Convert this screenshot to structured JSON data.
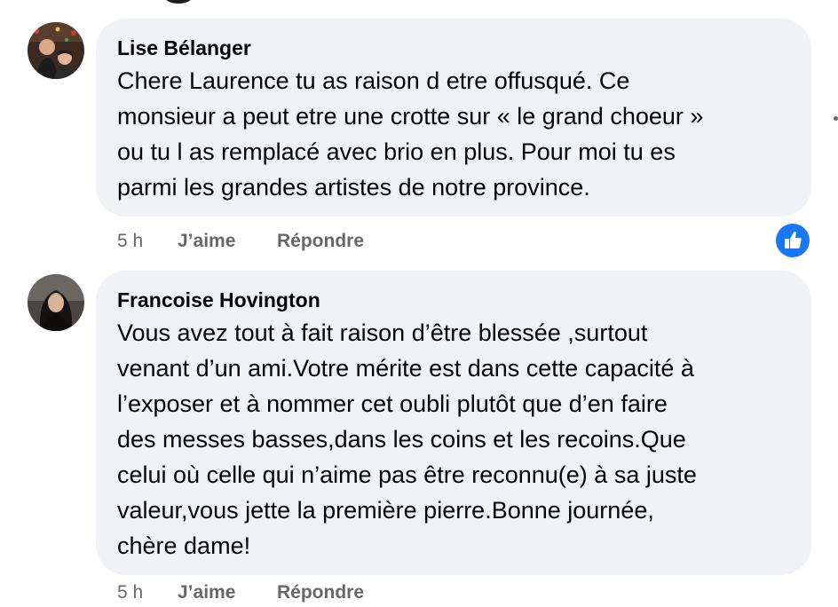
{
  "comments": [
    {
      "author": "Lise Bélanger",
      "text": "Chere Laurence tu as raison d etre offusqué. Ce\nmonsieur a peut etre une crotte sur « le grand choeur »\nou tu l as remplacé avec brio en plus. Pour moi tu es\nparmi les grandes artistes de notre province.",
      "time": "5 h",
      "like_label": "J’aime",
      "reply_label": "Répondre",
      "reaction_icon": "like-reaction-icon",
      "reaction_color": "#1877f2"
    },
    {
      "author": "Francoise Hovington",
      "text": "Vous avez tout à fait raison d’être blessée ,surtout\nvenant d’un ami.Votre mérite est dans cette capacité à\nl’exposer et à nommer cet oubli plutôt que d’en faire\ndes messes basses,dans les coins et les recoins.Que\ncelui où celle qui n’aime pas être reconnu(e) à sa juste\nvaleur,vous jette la première pierre.Bonne journée,\nchère dame!",
      "time": "5 h",
      "like_label": "J’aime",
      "reply_label": "Répondre"
    }
  ],
  "colors": {
    "bubble_bg": "#f0f2f5",
    "secondary_text": "#65676b",
    "primary_text": "#050505",
    "accent": "#1877f2"
  }
}
